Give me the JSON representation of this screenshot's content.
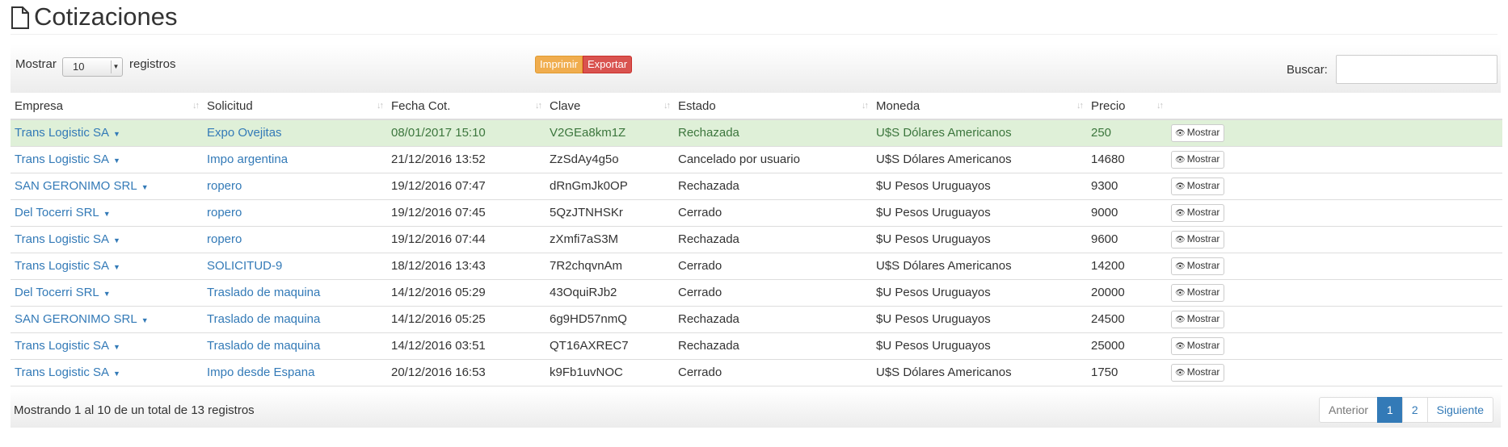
{
  "page": {
    "title": "Cotizaciones",
    "icon": "document-icon"
  },
  "toolbar": {
    "length_label": "Mostrar",
    "length_value": "10",
    "length_suffix": "registros",
    "print_label": "Imprimir",
    "export_label": "Exportar",
    "search_label": "Buscar:",
    "search_value": ""
  },
  "table": {
    "columns": [
      "Empresa",
      "Solicitud",
      "Fecha Cot.",
      "Clave",
      "Estado",
      "Moneda",
      "Precio",
      ""
    ],
    "action_label": "Mostrar",
    "rows": [
      {
        "empresa": "Trans Logistic SA",
        "solicitud": "Expo Ovejitas",
        "fecha": "08/01/2017 15:10",
        "clave": "V2GEa8km1Z",
        "estado": "Rechazada",
        "moneda": "U$S Dólares Americanos",
        "precio": "250"
      },
      {
        "empresa": "Trans Logistic SA",
        "solicitud": "Impo argentina",
        "fecha": "21/12/2016 13:52",
        "clave": "ZzSdAy4g5o",
        "estado": "Cancelado por usuario",
        "moneda": "U$S Dólares Americanos",
        "precio": "14680"
      },
      {
        "empresa": "SAN GERONIMO SRL",
        "solicitud": "ropero",
        "fecha": "19/12/2016 07:47",
        "clave": "dRnGmJk0OP",
        "estado": "Rechazada",
        "moneda": "$U Pesos Uruguayos",
        "precio": "9300"
      },
      {
        "empresa": "Del Tocerri SRL",
        "solicitud": "ropero",
        "fecha": "19/12/2016 07:45",
        "clave": "5QzJTNHSKr",
        "estado": "Cerrado",
        "moneda": "$U Pesos Uruguayos",
        "precio": "9000"
      },
      {
        "empresa": "Trans Logistic SA",
        "solicitud": "ropero",
        "fecha": "19/12/2016 07:44",
        "clave": "zXmfi7aS3M",
        "estado": "Rechazada",
        "moneda": "$U Pesos Uruguayos",
        "precio": "9600"
      },
      {
        "empresa": "Trans Logistic SA",
        "solicitud": "SOLICITUD-9",
        "fecha": "18/12/2016 13:43",
        "clave": "7R2chqvnAm",
        "estado": "Cerrado",
        "moneda": "U$S Dólares Americanos",
        "precio": "14200"
      },
      {
        "empresa": "Del Tocerri SRL",
        "solicitud": "Traslado de maquina",
        "fecha": "14/12/2016 05:29",
        "clave": "43OquiRJb2",
        "estado": "Cerrado",
        "moneda": "$U Pesos Uruguayos",
        "precio": "20000"
      },
      {
        "empresa": "SAN GERONIMO SRL",
        "solicitud": "Traslado de maquina",
        "fecha": "14/12/2016 05:25",
        "clave": "6g9HD57nmQ",
        "estado": "Rechazada",
        "moneda": "$U Pesos Uruguayos",
        "precio": "24500"
      },
      {
        "empresa": "Trans Logistic SA",
        "solicitud": "Traslado de maquina",
        "fecha": "14/12/2016 03:51",
        "clave": "QT16AXREC7",
        "estado": "Rechazada",
        "moneda": "$U Pesos Uruguayos",
        "precio": "25000"
      },
      {
        "empresa": "Trans Logistic SA",
        "solicitud": "Impo desde Espana",
        "fecha": "20/12/2016 16:53",
        "clave": "k9Fb1uvNOC",
        "estado": "Cerrado",
        "moneda": "U$S Dólares Americanos",
        "precio": "1750"
      }
    ]
  },
  "footer": {
    "info": "Mostrando 1 al 10 de un total de 13 registros",
    "prev_label": "Anterior",
    "pages": [
      "1",
      "2"
    ],
    "next_label": "Siguiente"
  },
  "colors": {
    "link": "#337ab7",
    "highlight_row": "#dff0d8",
    "print_button": "#f0ad4e",
    "export_button": "#d9534f",
    "active_page": "#337ab7"
  }
}
